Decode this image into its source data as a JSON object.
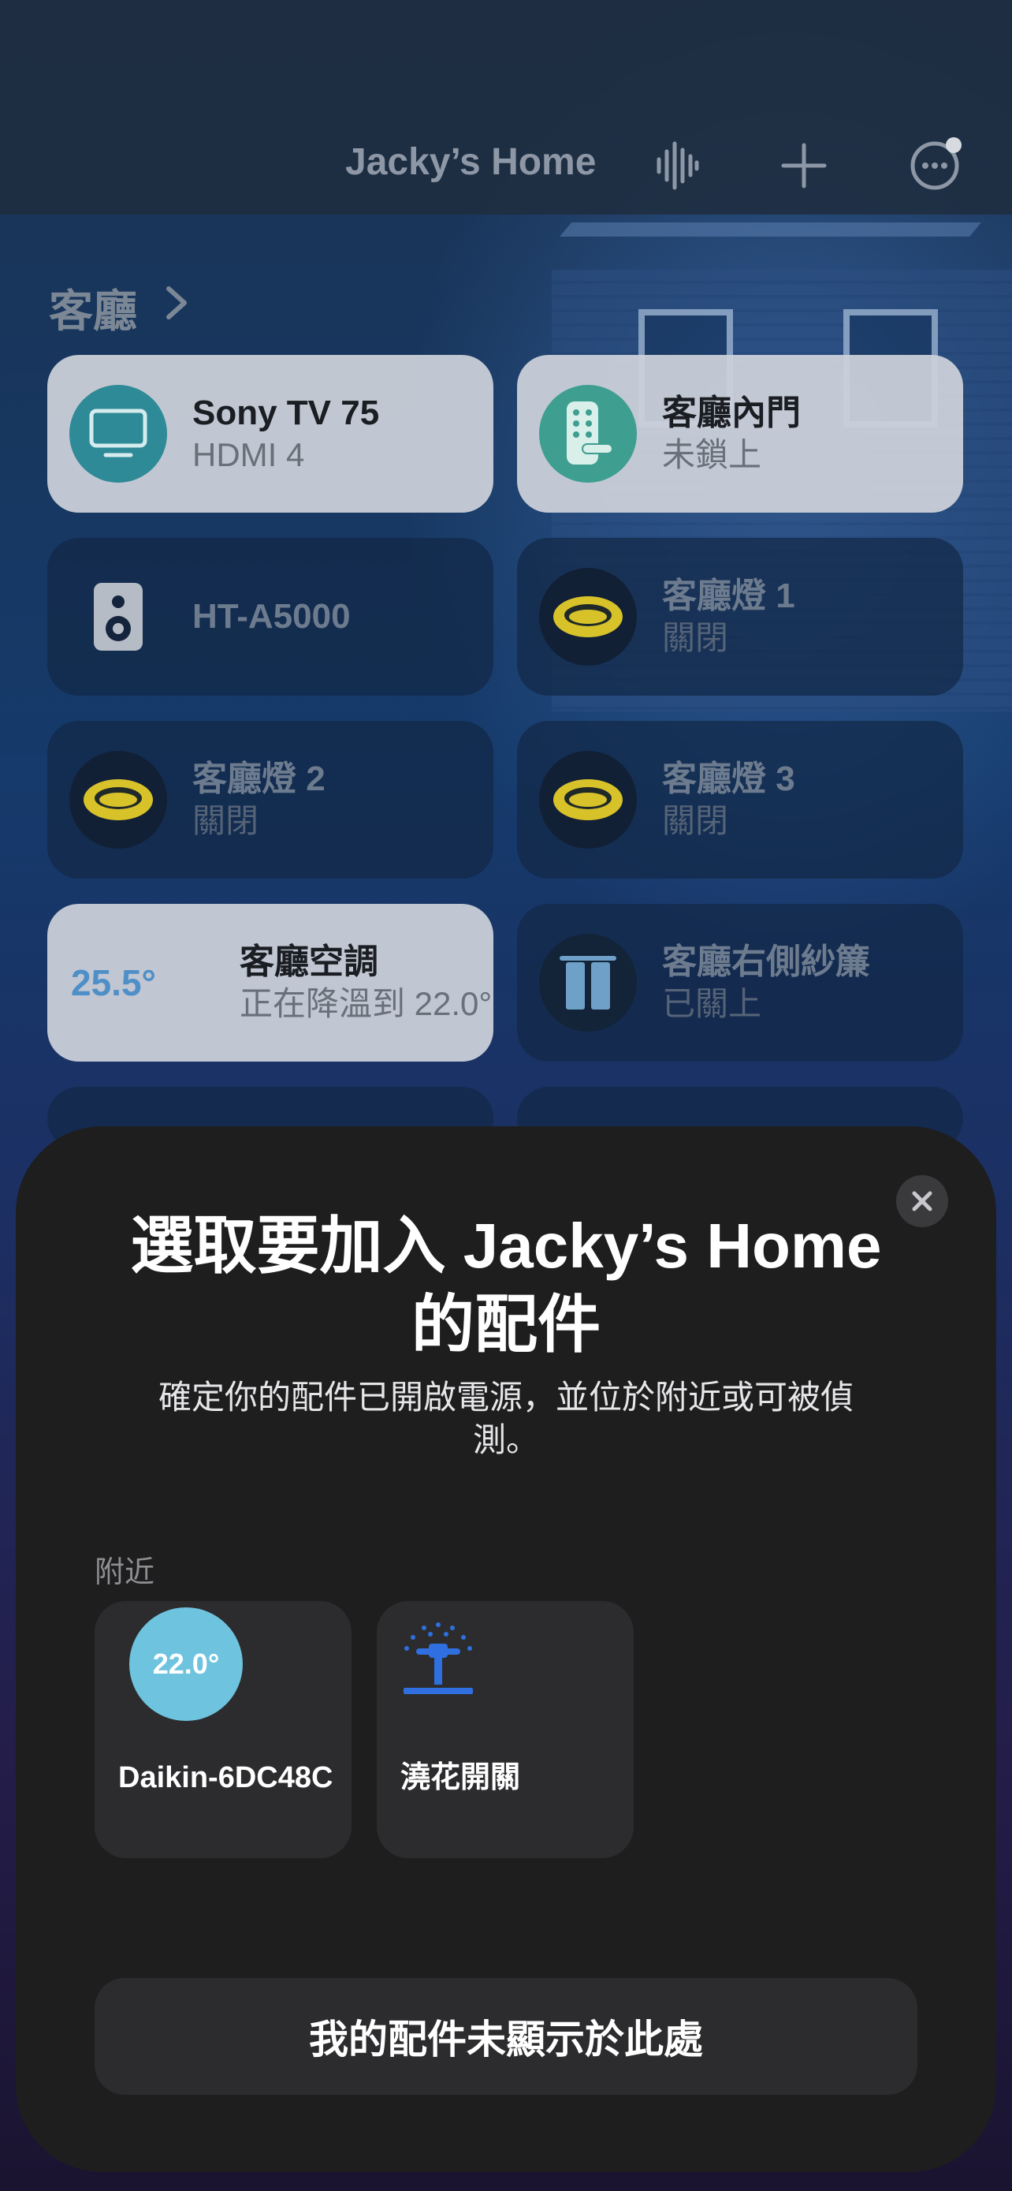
{
  "header": {
    "title": "Jacky’s Home",
    "icons": [
      "voice-waveform-icon",
      "plus-icon",
      "more-icon"
    ]
  },
  "room": {
    "title": "客廳",
    "tiles": [
      {
        "name": "Sony TV 75",
        "status": "HDMI 4",
        "icon": "tv-icon",
        "active": true
      },
      {
        "name": "客廳內門",
        "status": "未鎖上",
        "icon": "lock-icon",
        "active": true
      },
      {
        "name": "HT-A5000",
        "status": "",
        "icon": "speaker-icon",
        "active": false
      },
      {
        "name": "客廳燈 1",
        "status": "關閉",
        "icon": "light-icon",
        "active": false
      },
      {
        "name": "客廳燈 2",
        "status": "關閉",
        "icon": "light-icon",
        "active": false
      },
      {
        "name": "客廳燈 3",
        "status": "關閉",
        "icon": "light-icon",
        "active": false
      },
      {
        "name": "客廳空調",
        "status": "正在降溫到 22.0°",
        "temperature": "25.5°",
        "active": true
      },
      {
        "name": "客廳右側紗簾",
        "status": "已關上",
        "icon": "curtain-icon",
        "active": false
      }
    ]
  },
  "sheet": {
    "title": "選取要加入 Jacky’s Home 的配件",
    "subtitle": "確定你的配件已開啟電源，並位於附近或可被偵測。",
    "nearby_label": "附近",
    "accessories": [
      {
        "name": "Daikin-6DC48C",
        "temperature": "22.0°",
        "icon": "thermostat-icon"
      },
      {
        "name": "澆花開關",
        "icon": "sprinkler-icon"
      }
    ],
    "not_shown_button": "我的配件未顯示於此處"
  },
  "colors": {
    "accent_blue": "#4f8fc8",
    "thermostat": "#6ec3de",
    "sprinkler": "#2f6fdf",
    "lock_teal": "#3e9e90",
    "tv_teal": "#2d8a96",
    "light_yellow": "#d8c22a"
  }
}
